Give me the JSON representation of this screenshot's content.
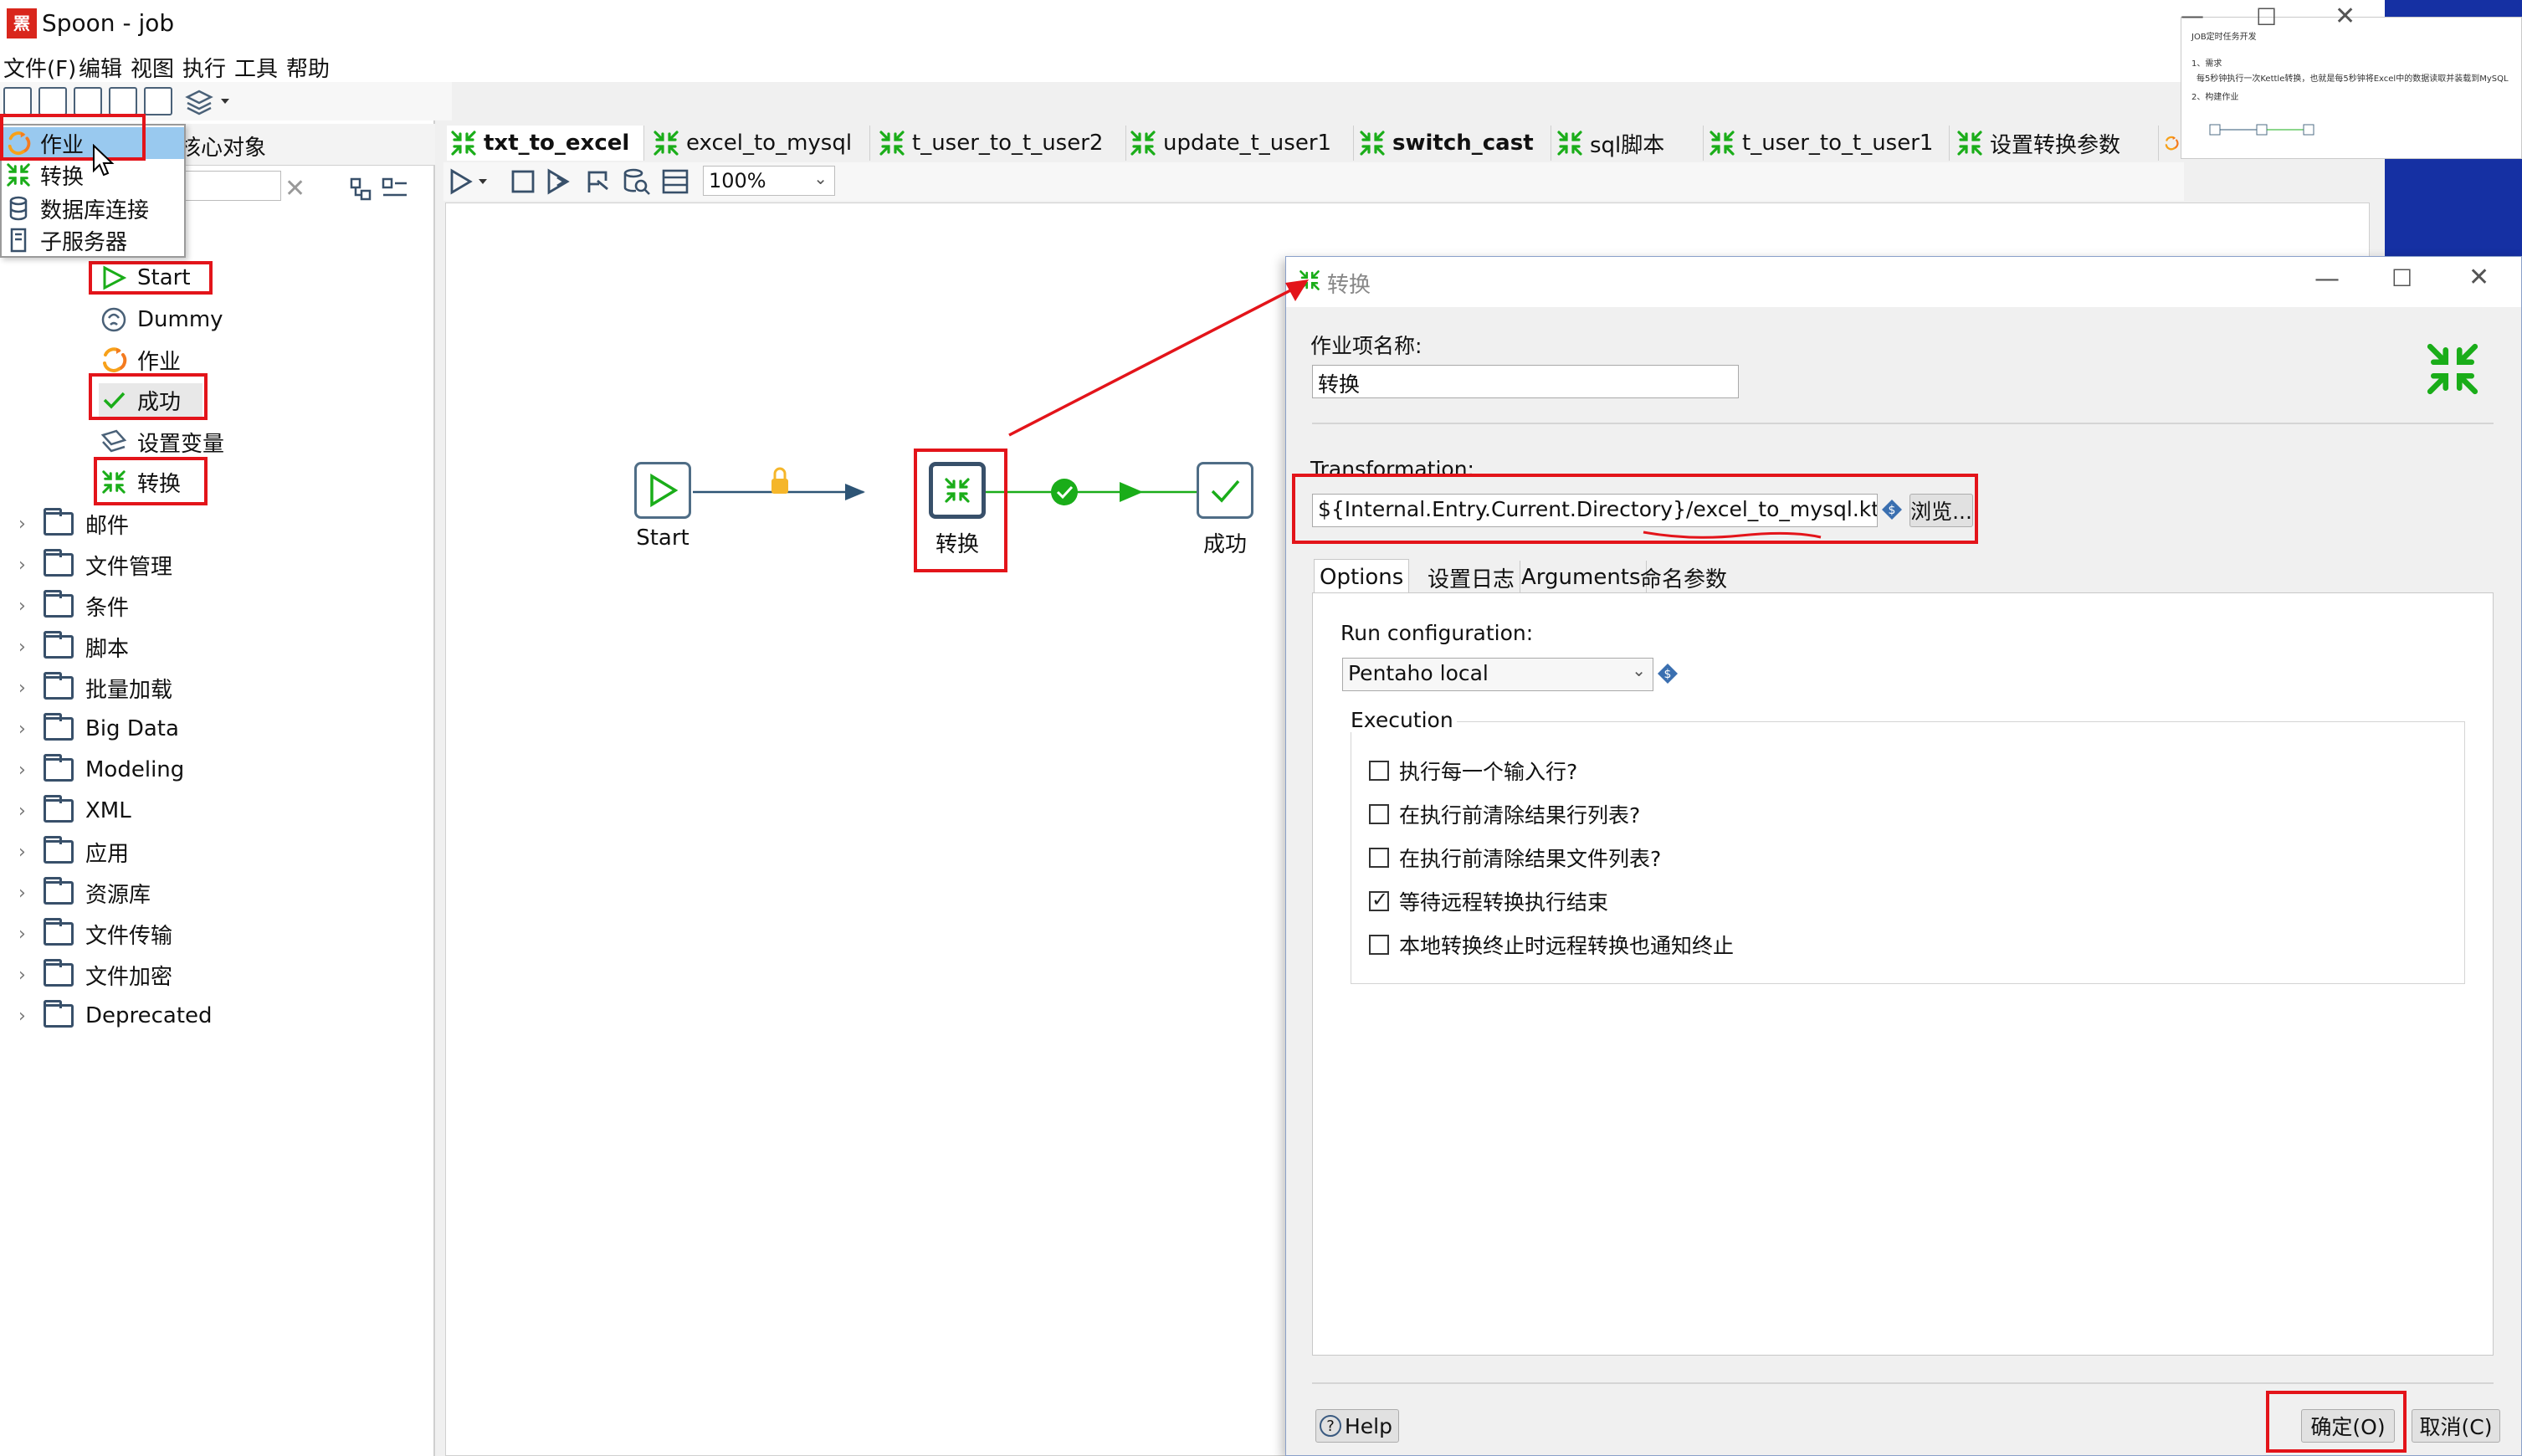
{
  "window": {
    "title": "Spoon - job",
    "logo_text": "罴"
  },
  "menu": [
    "文件(F)",
    "编辑",
    "视图",
    "执行",
    "工具",
    "帮助"
  ],
  "new_menu": {
    "items": [
      "作业",
      "转换",
      "数据库连接",
      "子服务器"
    ]
  },
  "left_panel": {
    "tab_label": "核心对象",
    "general_items": [
      "Start",
      "Dummy",
      "作业",
      "成功",
      "设置变量",
      "转换"
    ],
    "folders": [
      "邮件",
      "文件管理",
      "条件",
      "脚本",
      "批量加载",
      "Big Data",
      "Modeling",
      "XML",
      "应用",
      "资源库",
      "文件传输",
      "文件加密",
      "Deprecated"
    ]
  },
  "editor_tabs": [
    {
      "label": "txt_to_excel",
      "active": true
    },
    {
      "label": "excel_to_mysql",
      "active": false
    },
    {
      "label": "t_user_to_t_user2",
      "active": false
    },
    {
      "label": "update_t_user1",
      "active": false
    },
    {
      "label": "switch_cast",
      "active": false
    },
    {
      "label": "sql脚本",
      "active": false
    },
    {
      "label": "t_user_to_t_user1",
      "active": false
    },
    {
      "label": "设置转换参数",
      "active": false
    }
  ],
  "canvas_toolbar": {
    "zoom": "100%"
  },
  "job_graph": {
    "nodes": [
      {
        "id": "start",
        "label": "Start"
      },
      {
        "id": "trans",
        "label": "转换"
      },
      {
        "id": "success",
        "label": "成功"
      }
    ]
  },
  "popup": {
    "title": "JOB定时任务开发",
    "line1": "1、需求",
    "line2": "每5秒钟执行一次Kettle转换，也就是每5秒钟将Excel中的数据读取并装载到MySQL",
    "line3": "2、构建作业"
  },
  "dialog": {
    "title": "转换",
    "job_entry_name_label": "作业项名称:",
    "job_entry_name_value": "转换",
    "transformation_label": "Transformation:",
    "transformation_value": "${Internal.Entry.Current.Directory}/excel_to_mysql.ktr",
    "browse_label": "浏览...",
    "tabs": [
      "Options",
      "设置日志",
      "Arguments",
      "命名参数"
    ],
    "run_config_label": "Run configuration:",
    "run_config_value": "Pentaho local",
    "execution_label": "Execution",
    "checkboxes": [
      {
        "label": "执行每一个输入行?",
        "checked": false
      },
      {
        "label": "在执行前清除结果行列表?",
        "checked": false
      },
      {
        "label": "在执行前清除结果文件列表?",
        "checked": false
      },
      {
        "label": "等待远程转换执行结束",
        "checked": true
      },
      {
        "label": "本地转换终止时远程转换也通知终止",
        "checked": false
      }
    ],
    "help_label": "Help",
    "ok_label": "确定(O)",
    "cancel_label": "取消(C)"
  },
  "colors": {
    "annotation_red": "#e3141a",
    "hop_blue": "#2d5475",
    "hop_green": "#1aad19",
    "node_border": "#4f6d86",
    "menu_highlight": "#99c9ef",
    "desktop_blue": "#1530a3"
  }
}
